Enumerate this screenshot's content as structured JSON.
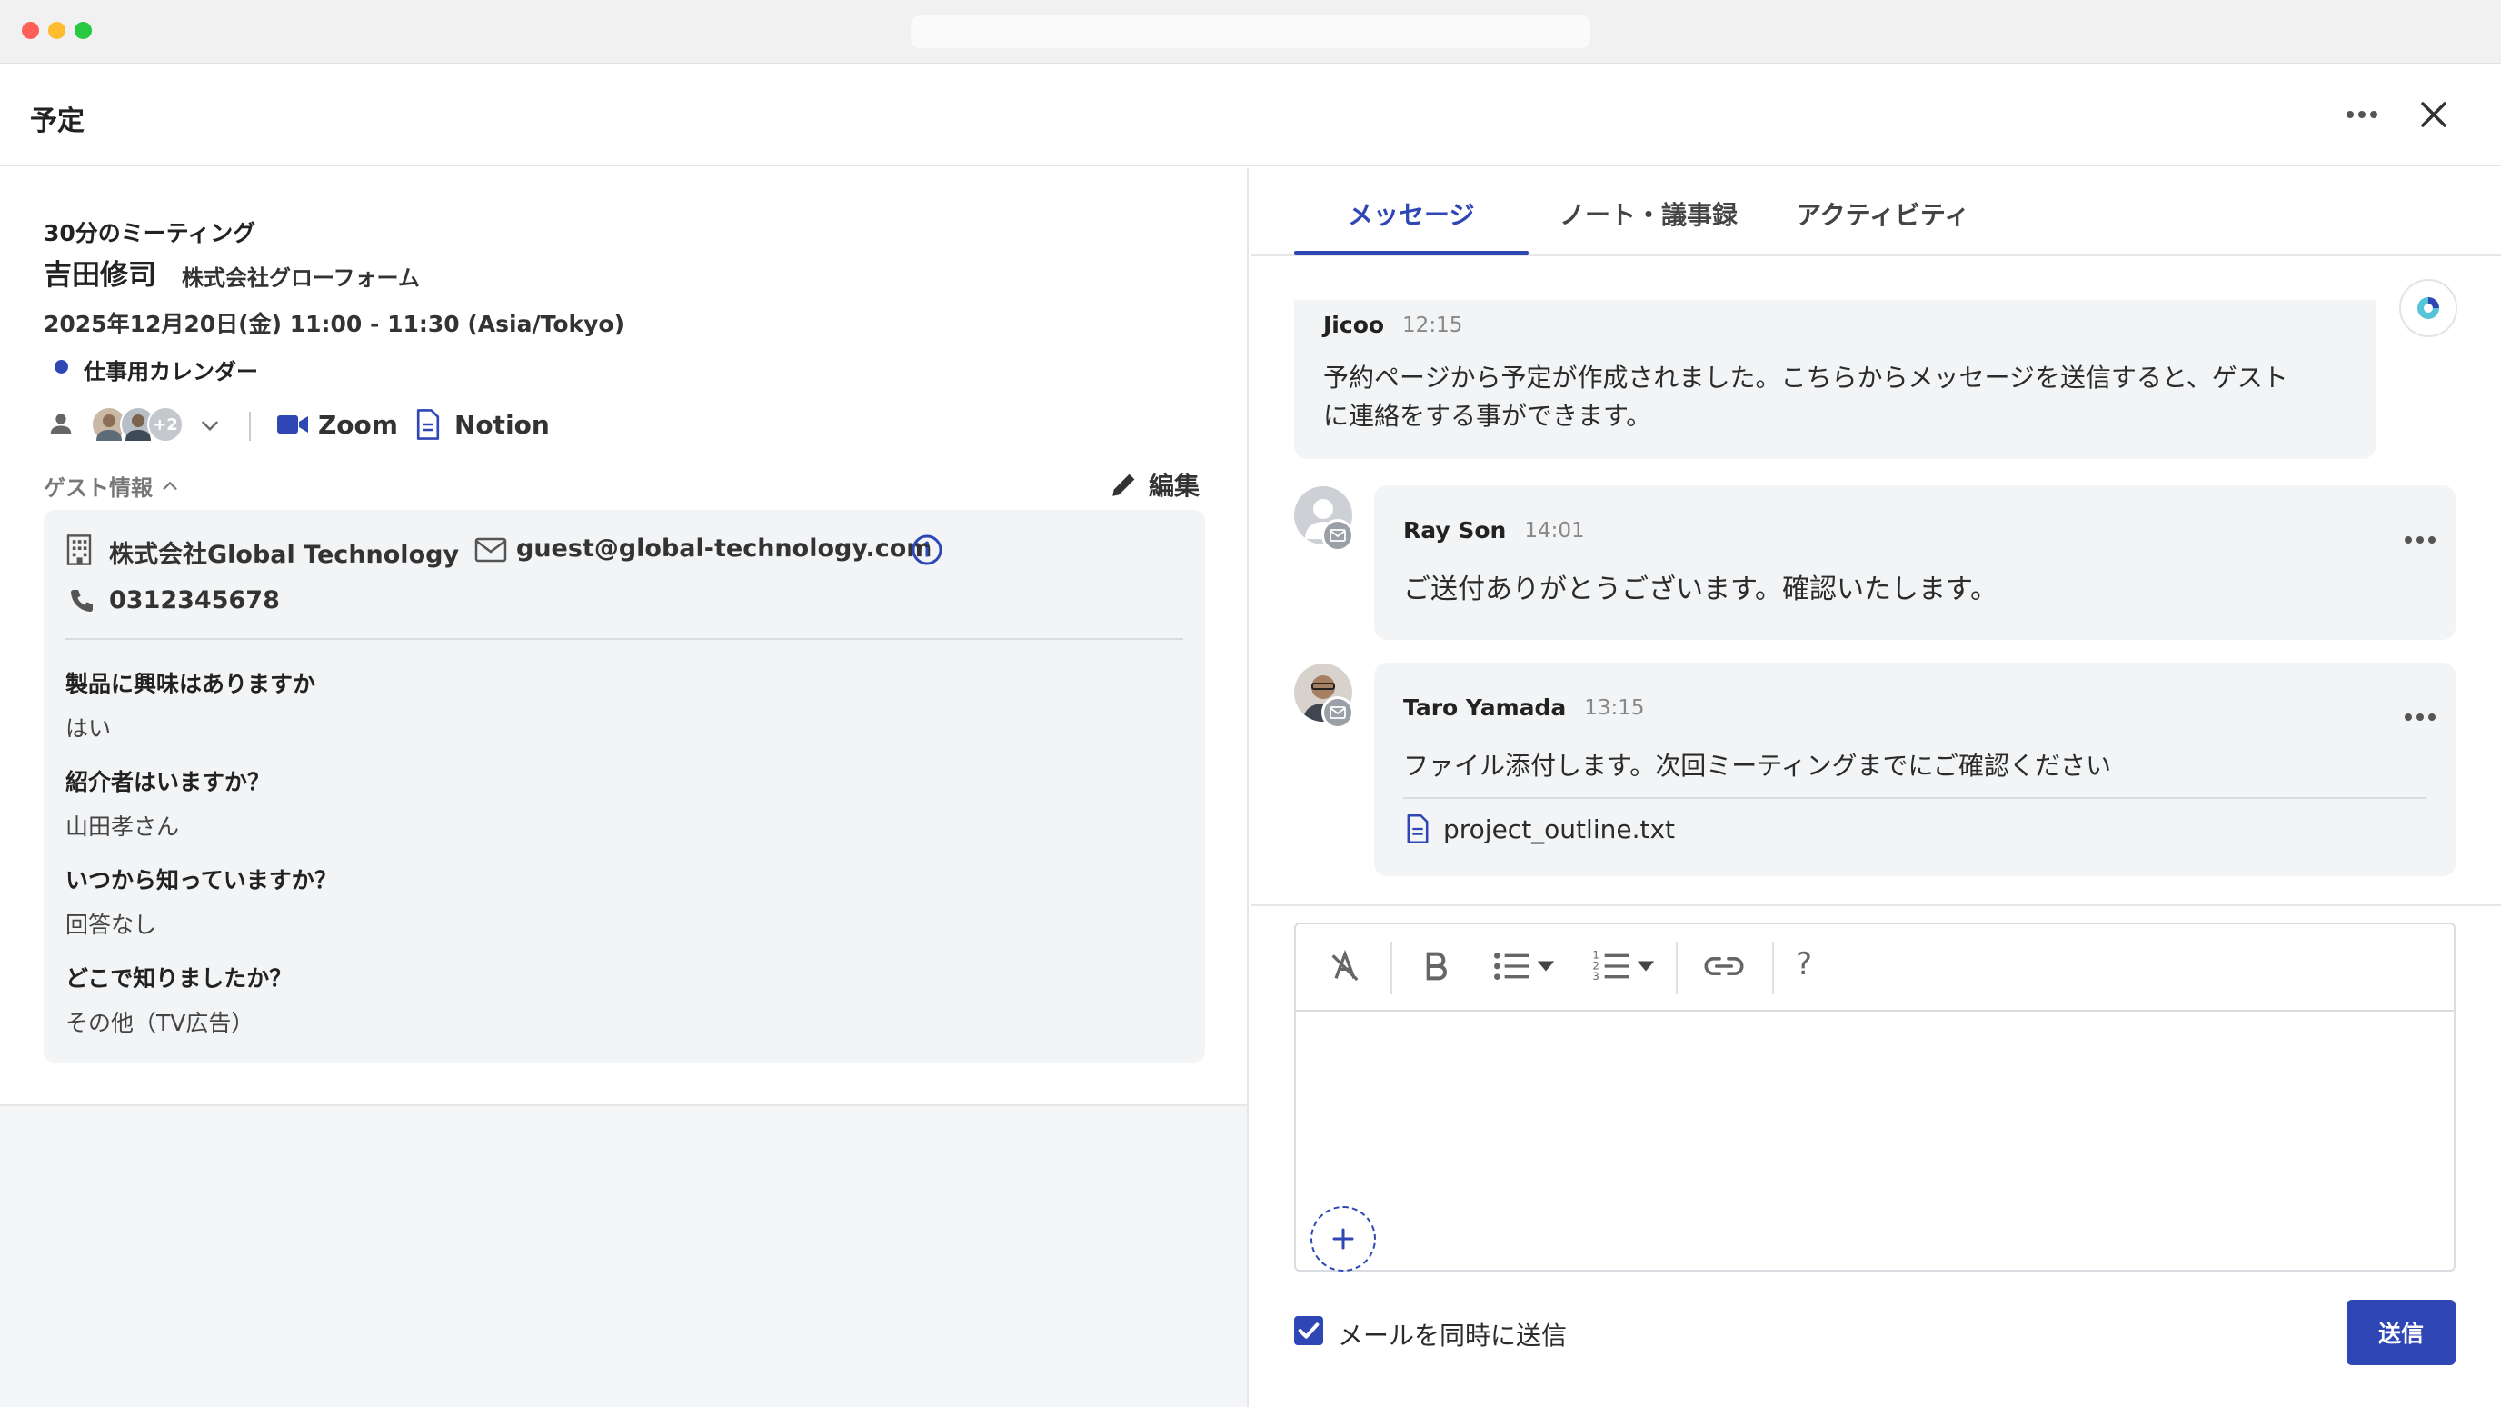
{
  "header": {
    "title": "予定"
  },
  "event": {
    "meeting_type": "30分のミーティング",
    "guest_name": "吉田修司",
    "guest_company": "株式会社グローフォーム",
    "datetime": "2025年12月20日(金) 11:00 - 11:30 (Asia/Tokyo)",
    "calendar": "仕事用カレンダー",
    "attendees_extra": "+2",
    "conferencing": "Zoom",
    "notes_app": "Notion"
  },
  "guest_info": {
    "label": "ゲスト情報",
    "edit_label": "編集",
    "company": "株式会社Global Technology",
    "email": "guest@global-technology.com",
    "phone": "0312345678",
    "qa": [
      {
        "q": "製品に興味はありますか",
        "a": "はい"
      },
      {
        "q": "紹介者はいますか？",
        "a": "山田孝さん"
      },
      {
        "q": "いつから知っていますか？",
        "a": "回答なし"
      },
      {
        "q": "どこで知りましたか？",
        "a": "その他（TV広告）"
      }
    ]
  },
  "tabs": [
    {
      "label": "メッセージ",
      "active": true
    },
    {
      "label": "ノート・議事録",
      "active": false
    },
    {
      "label": "アクティビティ",
      "active": false
    }
  ],
  "messages": [
    {
      "sender": "Jicoo",
      "time": "12:15",
      "body_line1": "予約ページから予定が作成されました。こちらからメッセージを送信すると、ゲスト",
      "body_line2": "に連絡をする事ができます。"
    },
    {
      "sender": "Ray Son",
      "time": "14:01",
      "body": "ご送付ありがとうございます。確認いたします。"
    },
    {
      "sender": "Taro Yamada",
      "time": "13:15",
      "body": "ファイル添付します。次回ミーティングまでにご確認ください",
      "attachment": "project_outline.txt"
    }
  ],
  "composer": {
    "help_label": "?",
    "email_checkbox_label": "メールを同時に送信",
    "email_checked": true,
    "send_label": "送信"
  },
  "colors": {
    "accent": "#2e47b5"
  }
}
